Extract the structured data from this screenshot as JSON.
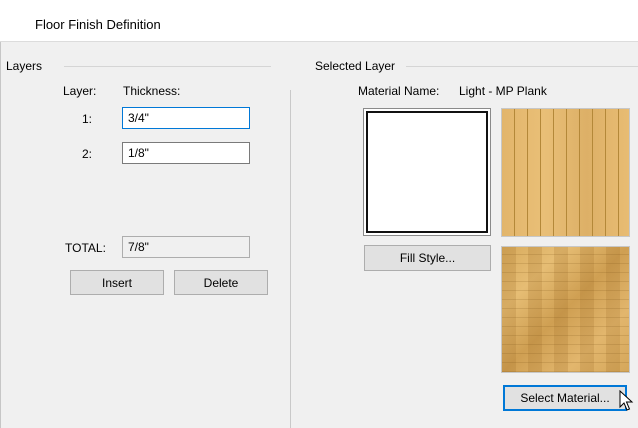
{
  "window": {
    "title": "Floor Finish Definition"
  },
  "layers_panel": {
    "group_label": "Layers",
    "col_layer": "Layer:",
    "col_thickness": "Thickness:",
    "rows": [
      {
        "index": "1:",
        "thickness": "3/4\""
      },
      {
        "index": "2:",
        "thickness": "1/8\""
      }
    ],
    "total_label": "TOTAL:",
    "total_value": "7/8\"",
    "insert_label": "Insert",
    "delete_label": "Delete"
  },
  "selected_layer": {
    "group_label": "Selected Layer",
    "material_name_label": "Material Name:",
    "material_name_value": "Light - MP Plank",
    "fill_style_label": "Fill Style...",
    "select_material_label": "Select Material..."
  }
}
